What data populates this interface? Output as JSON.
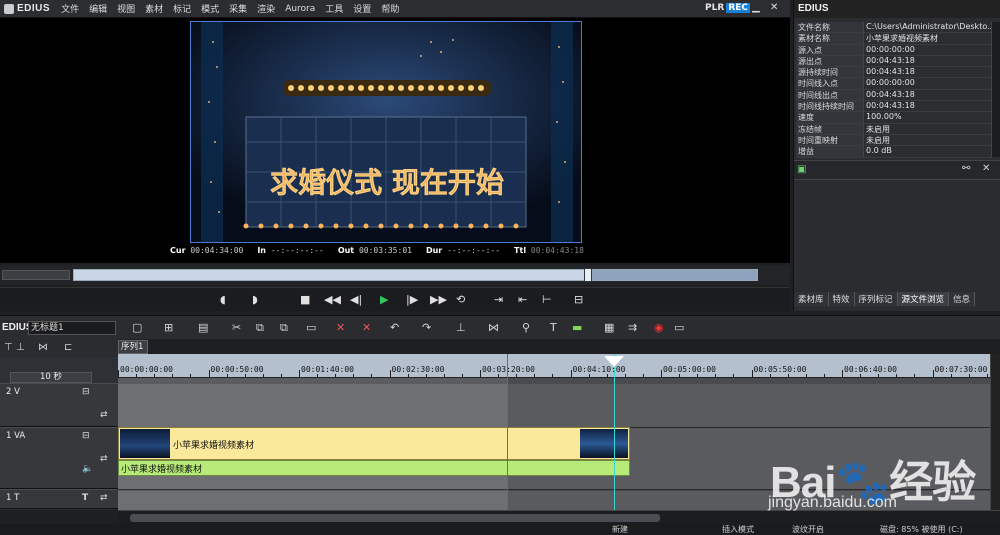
{
  "app": {
    "name": "EDIUS",
    "plr": "PLR",
    "rec": "REC"
  },
  "menu": [
    "文件",
    "编辑",
    "视图",
    "素材",
    "标记",
    "模式",
    "采集",
    "渲染",
    "Aurora",
    "工具",
    "设置",
    "帮助"
  ],
  "preview": {
    "overlay_text": "求婚仪式 现在开始",
    "cur_label": "Cur",
    "cur": "00:04:34:00",
    "in_label": "In",
    "in": "--:--:--:--",
    "out_label": "Out",
    "out": "00:03:35:01",
    "dur_label": "Dur",
    "dur": "--:--:--:--",
    "ttl_label": "Ttl",
    "ttl": "00:04:43:18"
  },
  "scrubber": {
    "progress": 0.75
  },
  "right_panel": {
    "title": "EDIUS",
    "properties": [
      {
        "k": "文件名称",
        "v": "C:\\Users\\Administrator\\Deskto..."
      },
      {
        "k": "素材名称",
        "v": "小苹果求婚视频素材"
      },
      {
        "k": "源入点",
        "v": "00:00:00:00"
      },
      {
        "k": "源出点",
        "v": "00:04:43:18"
      },
      {
        "k": "源持续时间",
        "v": "00:04:43:18"
      },
      {
        "k": "时间线入点",
        "v": "00:00:00:00"
      },
      {
        "k": "时间线出点",
        "v": "00:04:43:18"
      },
      {
        "k": "时间线持续时间",
        "v": "00:04:43:18"
      },
      {
        "k": "速度",
        "v": "100.00%"
      },
      {
        "k": "冻结帧",
        "v": "未启用"
      },
      {
        "k": "时间重映射",
        "v": "未启用"
      },
      {
        "k": "增益",
        "v": "0.0 dB"
      }
    ],
    "tabs": [
      "素材库",
      "特效",
      "序列标记",
      "源文件浏览",
      "信息"
    ]
  },
  "timeline": {
    "edius_label": "EDIUS",
    "project_name": "无标题1",
    "sequence_tab": "序列1",
    "scale": "10 秒",
    "ruler": [
      "00:00:00:00",
      "00:00:50:00",
      "00:01:40:00",
      "00:02:30:00",
      "00:03:20:00",
      "00:04:10:00",
      "00:05:00:00",
      "00:05:50:00",
      "00:06:40:00",
      "00:07:30:00"
    ],
    "tracks": {
      "v2": "2 V",
      "va": "1 VA",
      "t": "1 T"
    },
    "clip_video_label": "小苹果求婚视频素材",
    "clip_audio_label": "小苹果求婚视频素材"
  },
  "statusbar": {
    "new": "新建",
    "insert_mode": "插入模式",
    "ripple": "波纹开启",
    "disk": "磁盘: 85% 被使用 (C:)"
  },
  "watermark": {
    "logo": "Bai🐾经验",
    "url": "jingyan.baidu.com"
  },
  "colors": {
    "accent": "#1a7fd6",
    "clip_video": "#fae99a",
    "clip_audio": "#b6eb7a",
    "ruler": "#b5c0cf"
  }
}
